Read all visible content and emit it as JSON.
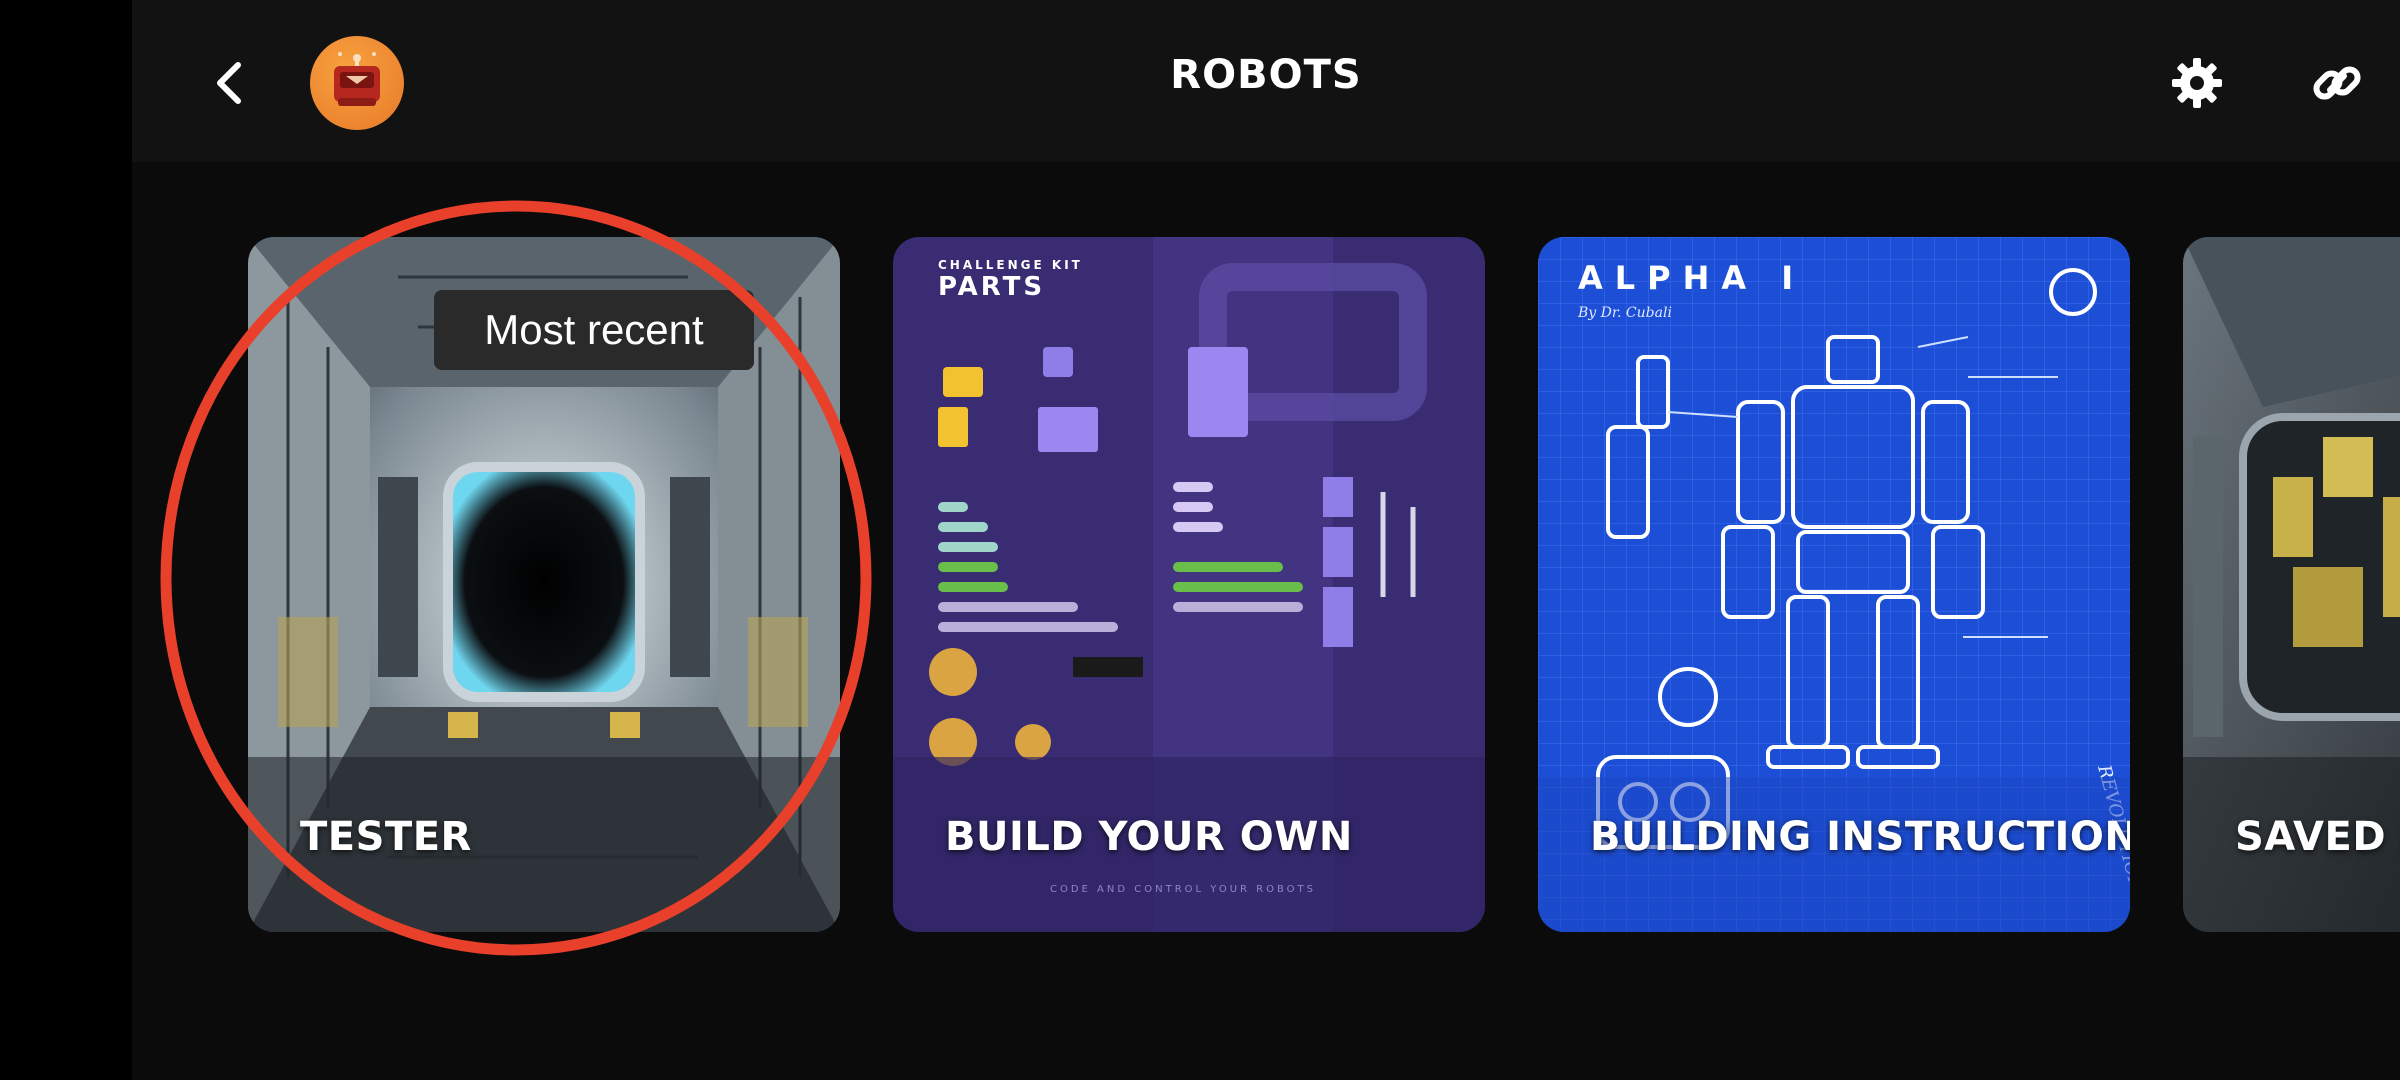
{
  "header": {
    "title": "ROBOTS",
    "back_icon": "chevron-left-icon",
    "avatar": "robot-avatar",
    "settings_icon": "gear-icon",
    "link_icon": "link-icon"
  },
  "cards": [
    {
      "label": "TESTER",
      "badge": "Most recent"
    },
    {
      "label": "BUILD YOUR OWN",
      "art_title_small": "CHALLENGE KIT",
      "art_title": "PARTS",
      "art_footer": "CODE AND CONTROL YOUR ROBOTS"
    },
    {
      "label": "BUILDING INSTRUCTIONS",
      "art_title": "ALPHA I",
      "art_subtitle": "By Dr. Cubali",
      "art_sidenote": "REVOLUTION ROBOTS"
    },
    {
      "label": "SAVED ROBOTS"
    }
  ],
  "colors": {
    "accent_avatar": "#f08a30",
    "annotation_red": "#e8402a",
    "blueprint": "#1c4fd6",
    "parts_purple": "#3a2c72"
  }
}
